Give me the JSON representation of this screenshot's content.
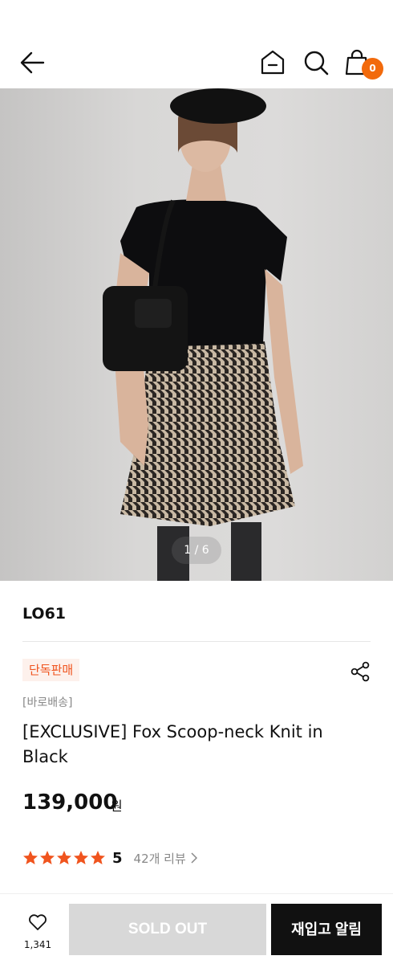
{
  "header": {
    "back_icon": "arrow-left-icon",
    "home_icon": "home-icon",
    "search_icon": "search-icon",
    "cart_icon": "shopping-bag-icon",
    "cart_count": "0",
    "badge_color": "#f26a0c"
  },
  "gallery": {
    "pager": "1 / 6"
  },
  "product": {
    "brand": "LO61",
    "exclusive_badge": "단독판매",
    "shipping": "[바로배송]",
    "title": "[EXCLUSIVE] Fox Scoop-neck Knit in Black",
    "price": "139,000",
    "price_unit": "원",
    "rating_score": "5",
    "rating_stars": 5,
    "review_link": "42개 리뷰",
    "share_icon": "share-icon",
    "star_color": "#f0541e"
  },
  "footer": {
    "like_icon": "heart-icon",
    "like_count": "1,341",
    "soldout_label": "SOLD OUT",
    "restock_label": "재입고 알림"
  }
}
